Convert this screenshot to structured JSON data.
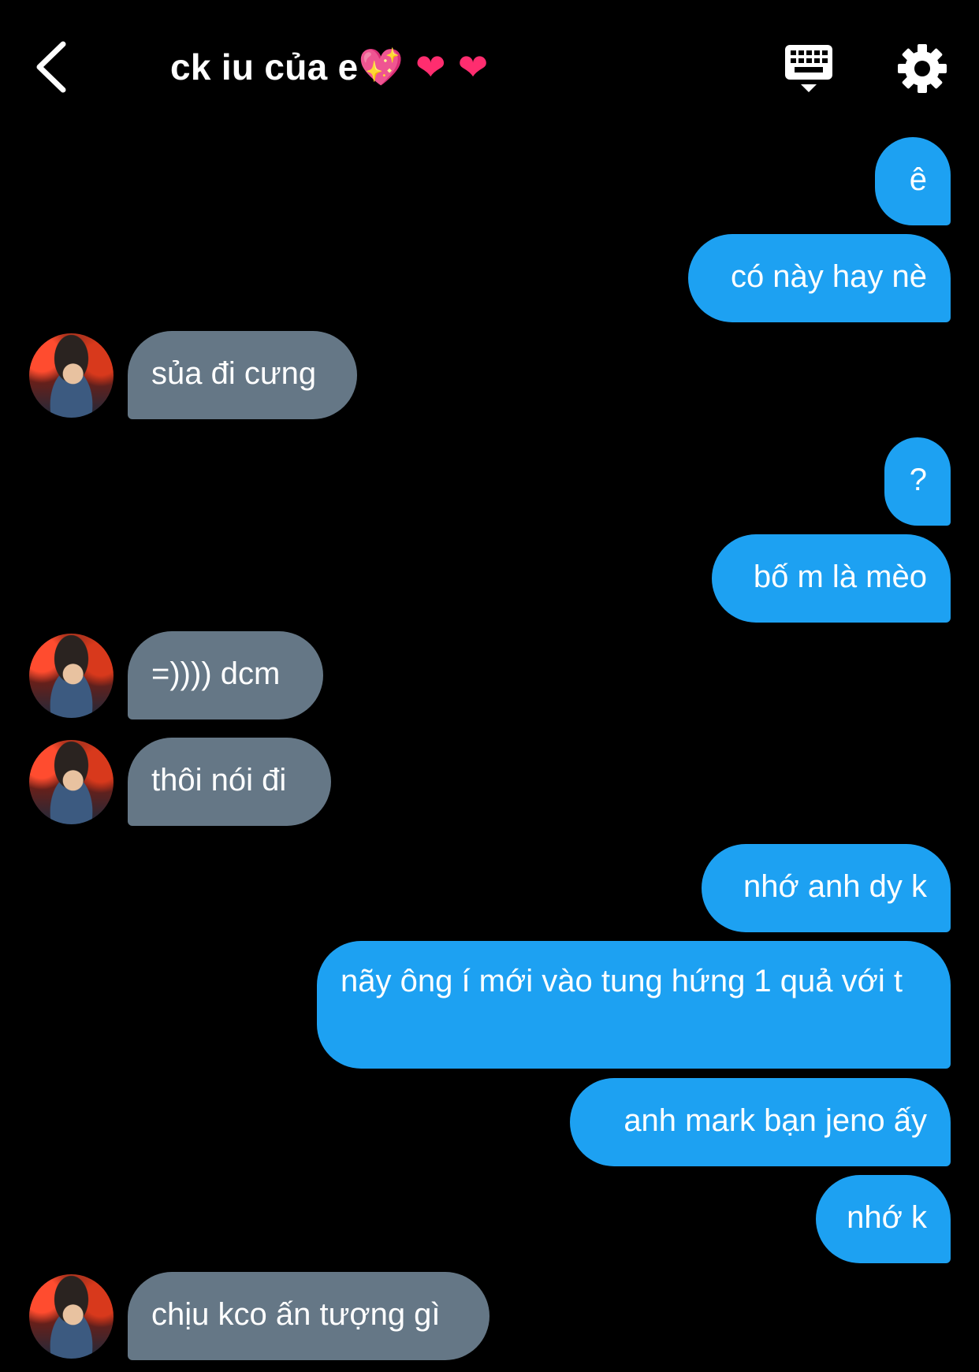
{
  "header": {
    "title": "ck iu của e",
    "title_emojis": "💖 ❤ ❤",
    "back_icon": "chevron-left-icon",
    "keyboard_icon": "keyboard-icon",
    "settings_icon": "gear-icon"
  },
  "colors": {
    "background": "#000000",
    "outgoing_bubble": "#1da1f2",
    "incoming_bubble": "#657786",
    "text": "#ffffff"
  },
  "messages": [
    {
      "from": "me",
      "text": "ê"
    },
    {
      "from": "me",
      "text": "có này hay nè"
    },
    {
      "from": "them",
      "text": "sủa đi cưng"
    },
    {
      "from": "me",
      "text": "?"
    },
    {
      "from": "me",
      "text": "bố m là mèo"
    },
    {
      "from": "them",
      "text": "=)))) dcm"
    },
    {
      "from": "them",
      "text": "thôi nói đi"
    },
    {
      "from": "me",
      "text": "nhớ anh dy k"
    },
    {
      "from": "me",
      "text": "nãy ông í mới vào tung hứng 1 quả với t"
    },
    {
      "from": "me",
      "text": "anh mark bạn jeno ấy"
    },
    {
      "from": "me",
      "text": "nhớ k"
    },
    {
      "from": "them",
      "text": "chịu kco ấn tượng gì"
    }
  ]
}
